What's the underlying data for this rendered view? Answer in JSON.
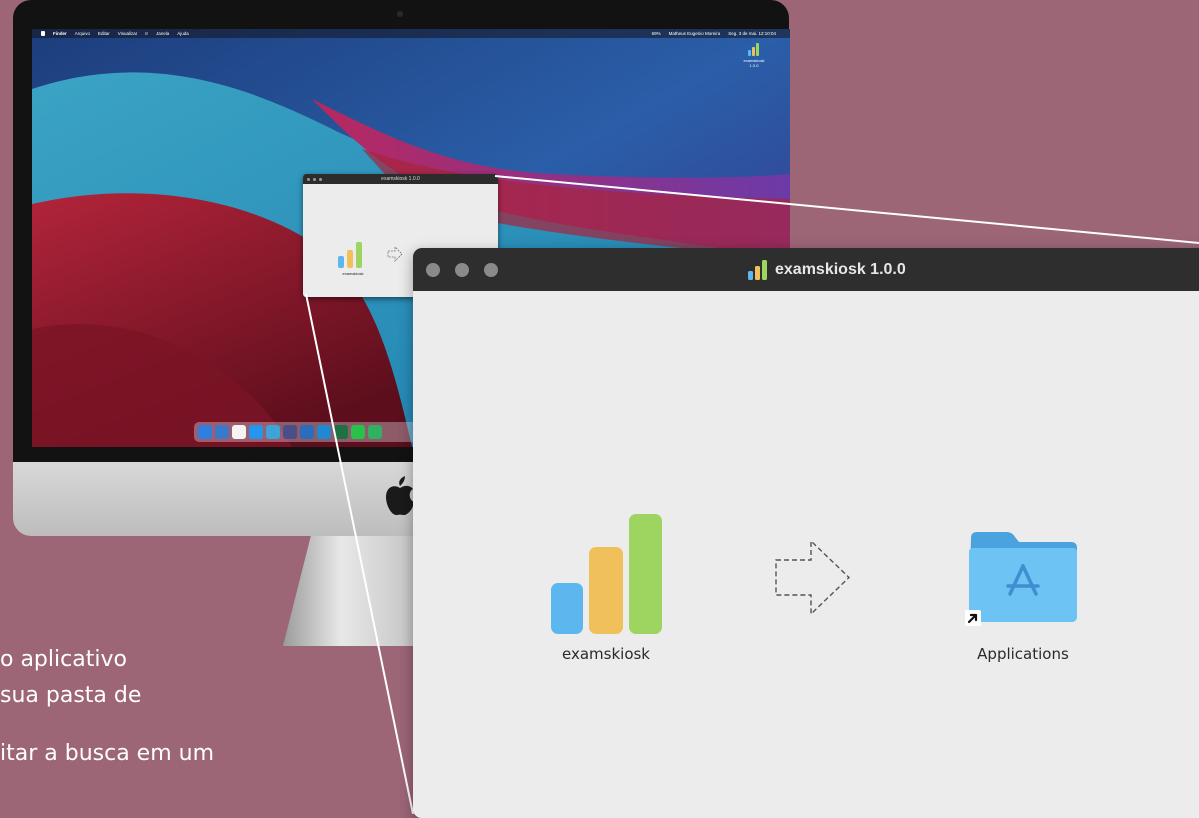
{
  "desktop": {
    "menubar": {
      "items": [
        "Finder",
        "Arquivo",
        "Editar",
        "Visualizar",
        "Ir",
        "Janela",
        "Ajuda"
      ],
      "battery": "69%",
      "user": "Matheus Eugenio Moreira",
      "clock": "Seg. 3 de mai. 12:10:04"
    },
    "desktop_icon": {
      "name": "examskiosk",
      "version": "1.0.0"
    },
    "mini_window": {
      "title": "examskiosk 1.0.0",
      "app_label": "examskiosk"
    }
  },
  "installer_window": {
    "title": "examskiosk 1.0.0",
    "app_label": "examskiosk",
    "folder_label": "Applications"
  },
  "caption": {
    "line1": "o aplicativo",
    "line2": "sua pasta de",
    "line3": "itar a busca em um"
  },
  "colors": {
    "background": "#9c6677",
    "bar_blue": "#5cb7ee",
    "bar_yellow": "#f0c05a",
    "bar_green": "#9dd560",
    "folder": "#6ec3f5"
  }
}
